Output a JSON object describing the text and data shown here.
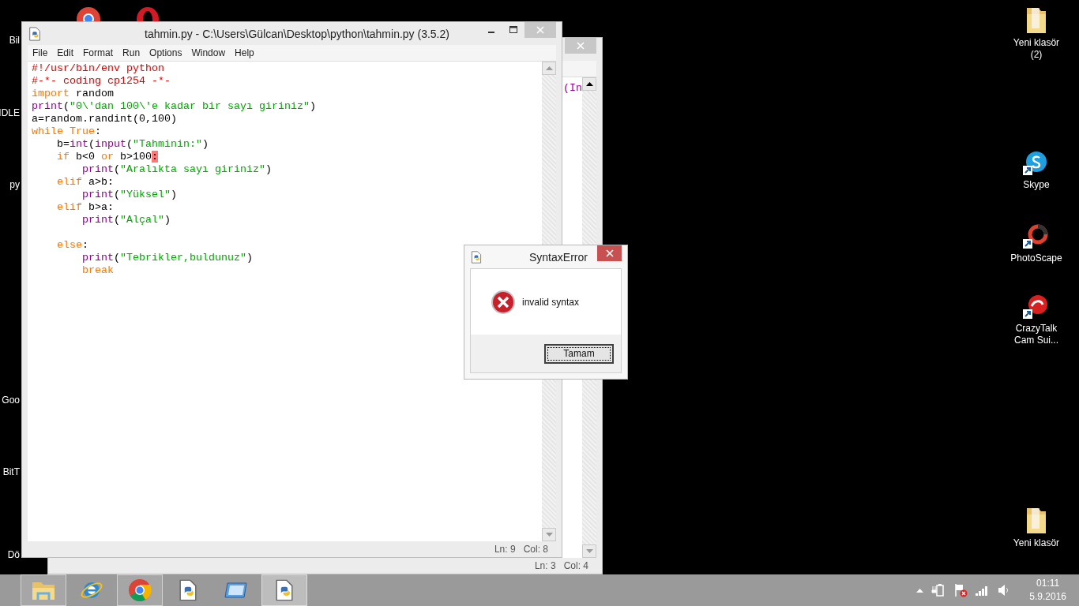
{
  "desktop_icons_left": [
    {
      "label": "Bil"
    },
    {
      "label": "IDLE"
    },
    {
      "label": "py"
    },
    {
      "label": "Goo"
    },
    {
      "label": "BitT"
    },
    {
      "label": "Dö"
    }
  ],
  "desktop_icons_right": [
    {
      "kind": "folder",
      "label_lines": [
        "Yeni klasör",
        "(2)"
      ]
    },
    {
      "kind": "skype",
      "label_lines": [
        "Skype"
      ]
    },
    {
      "kind": "photoscape",
      "label_lines": [
        "PhotoScape"
      ]
    },
    {
      "kind": "crazytalk",
      "label_lines": [
        "CrazyTalk",
        "Cam Sui..."
      ]
    },
    {
      "kind": "folder",
      "label_lines": [
        "Yeni klasör"
      ]
    }
  ],
  "back_window": {
    "visible_text": "(In",
    "status": {
      "line": "Ln: 3",
      "col": "Col: 4"
    }
  },
  "editor_window": {
    "title": "tahmin.py - C:\\Users\\Gülcan\\Desktop\\python\\tahmin.py (3.5.2)",
    "menu": [
      "File",
      "Edit",
      "Format",
      "Run",
      "Options",
      "Window",
      "Help"
    ],
    "code_lines": [
      {
        "tokens": [
          {
            "kind": "comment",
            "text": "#!/usr/bin/env python"
          }
        ]
      },
      {
        "tokens": [
          {
            "kind": "comment",
            "text": "#-*- coding cp1254 -*-"
          }
        ]
      },
      {
        "tokens": [
          {
            "kind": "keyword",
            "text": "import"
          },
          {
            "kind": "plain",
            "text": " random"
          }
        ]
      },
      {
        "tokens": [
          {
            "kind": "builtin",
            "text": "print"
          },
          {
            "kind": "plain",
            "text": "("
          },
          {
            "kind": "string",
            "text": "\"0\\'dan 100\\'e kadar bir sayı giriniz\""
          },
          {
            "kind": "plain",
            "text": ")"
          }
        ]
      },
      {
        "tokens": [
          {
            "kind": "plain",
            "text": "a=random.randint(0,100)"
          }
        ]
      },
      {
        "tokens": [
          {
            "kind": "keyword",
            "text": "while"
          },
          {
            "kind": "keyword",
            "text": " True"
          },
          {
            "kind": "plain",
            "text": ":"
          }
        ],
        "children": [
          {
            "tokens": [
              {
                "kind": "plain",
                "text": "b="
              },
              {
                "kind": "builtin",
                "text": "int"
              },
              {
                "kind": "plain",
                "text": "("
              },
              {
                "kind": "builtin",
                "text": "input"
              },
              {
                "kind": "plain",
                "text": "("
              },
              {
                "kind": "string",
                "text": "\"Tahminin:\""
              },
              {
                "kind": "plain",
                "text": ")"
              }
            ]
          },
          {
            "tokens": [
              {
                "kind": "keyword",
                "text": "if"
              },
              {
                "kind": "plain",
                "text": " b<0 "
              },
              {
                "kind": "keyword",
                "text": "or"
              },
              {
                "kind": "plain",
                "text": " b>100"
              },
              {
                "kind": "error",
                "text": ":"
              }
            ],
            "children": [
              {
                "tokens": [
                  {
                    "kind": "builtin",
                    "text": "print"
                  },
                  {
                    "kind": "plain",
                    "text": "("
                  },
                  {
                    "kind": "string",
                    "text": "\"Aralıkta sayı giriniz\""
                  },
                  {
                    "kind": "plain",
                    "text": ")"
                  }
                ]
              }
            ]
          },
          {
            "tokens": [
              {
                "kind": "keyword",
                "text": "elif"
              },
              {
                "kind": "plain",
                "text": " a>b:"
              }
            ],
            "children": [
              {
                "tokens": [
                  {
                    "kind": "builtin",
                    "text": "print"
                  },
                  {
                    "kind": "plain",
                    "text": "("
                  },
                  {
                    "kind": "string",
                    "text": "\"Yüksel\""
                  },
                  {
                    "kind": "plain",
                    "text": ")"
                  }
                ]
              }
            ]
          },
          {
            "tokens": [
              {
                "kind": "keyword",
                "text": "elif"
              },
              {
                "kind": "plain",
                "text": " b>a:"
              }
            ],
            "children": [
              {
                "tokens": [
                  {
                    "kind": "builtin",
                    "text": "print"
                  },
                  {
                    "kind": "plain",
                    "text": "("
                  },
                  {
                    "kind": "string",
                    "text": "\"Alçal\""
                  },
                  {
                    "kind": "plain",
                    "text": ")"
                  }
                ]
              }
            ]
          },
          {
            "kind": "blank"
          },
          {
            "tokens": [
              {
                "kind": "keyword",
                "text": "else"
              },
              {
                "kind": "plain",
                "text": ":"
              }
            ],
            "children": [
              {
                "tokens": [
                  {
                    "kind": "builtin",
                    "text": "print"
                  },
                  {
                    "kind": "plain",
                    "text": "("
                  },
                  {
                    "kind": "string",
                    "text": "\"Tebrikler,buldunuz\""
                  },
                  {
                    "kind": "plain",
                    "text": ")"
                  }
                ]
              },
              {
                "tokens": [
                  {
                    "kind": "keyword",
                    "text": "break"
                  }
                ]
              }
            ]
          }
        ]
      }
    ],
    "status": {
      "line": "Ln: 9",
      "col": "Col: 8"
    }
  },
  "dialog": {
    "title": "SyntaxError",
    "message": "invalid syntax",
    "button": "Tamam"
  },
  "taskbar": {
    "apps": [
      {
        "kind": "explorer",
        "running": true,
        "selected": false
      },
      {
        "kind": "ie",
        "running": false,
        "selected": false
      },
      {
        "kind": "chrome",
        "running": true,
        "selected": false
      },
      {
        "kind": "python",
        "running": false,
        "selected": false
      },
      {
        "kind": "window",
        "running": false,
        "selected": false
      },
      {
        "kind": "python",
        "running": true,
        "selected": true
      }
    ],
    "clock": {
      "time": "01:11",
      "date": "5.9.2016"
    }
  }
}
